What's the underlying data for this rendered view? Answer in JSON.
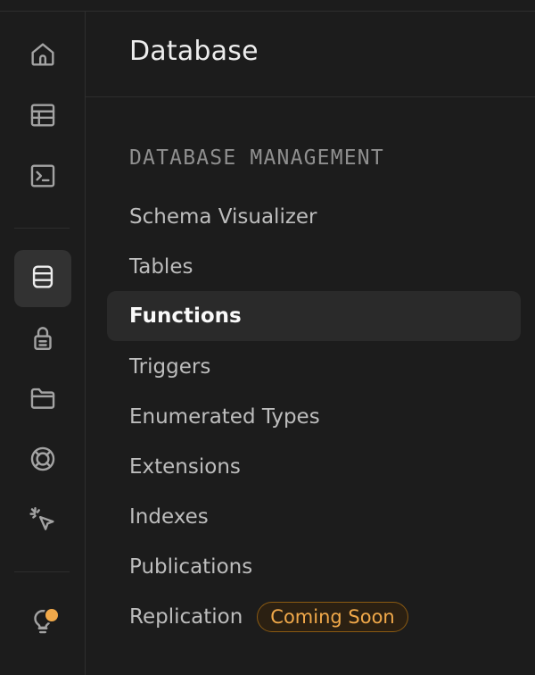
{
  "panel": {
    "title": "Database",
    "section_label": "DATABASE MANAGEMENT"
  },
  "rail": {
    "items": [
      {
        "icon": "home-icon"
      },
      {
        "icon": "table-editor-icon"
      },
      {
        "icon": "sql-editor-icon"
      },
      {
        "icon": "database-icon",
        "active": true
      },
      {
        "icon": "auth-lock-icon"
      },
      {
        "icon": "storage-folder-icon"
      },
      {
        "icon": "realtime-icon"
      },
      {
        "icon": "cursor-click-icon"
      },
      {
        "icon": "lightbulb-icon",
        "notification_dot_color": "#f1a94a"
      }
    ]
  },
  "menu": {
    "items": [
      {
        "label": "Schema Visualizer"
      },
      {
        "label": "Tables"
      },
      {
        "label": "Functions",
        "active": true
      },
      {
        "label": "Triggers"
      },
      {
        "label": "Enumerated Types"
      },
      {
        "label": "Extensions"
      },
      {
        "label": "Indexes"
      },
      {
        "label": "Publications"
      },
      {
        "label": "Replication",
        "badge": "Coming Soon"
      }
    ]
  },
  "colors": {
    "background": "#1c1c1c",
    "active_item_bg": "#2a2a2a",
    "badge_text": "#f1a94a",
    "badge_border": "#8a5a12"
  }
}
